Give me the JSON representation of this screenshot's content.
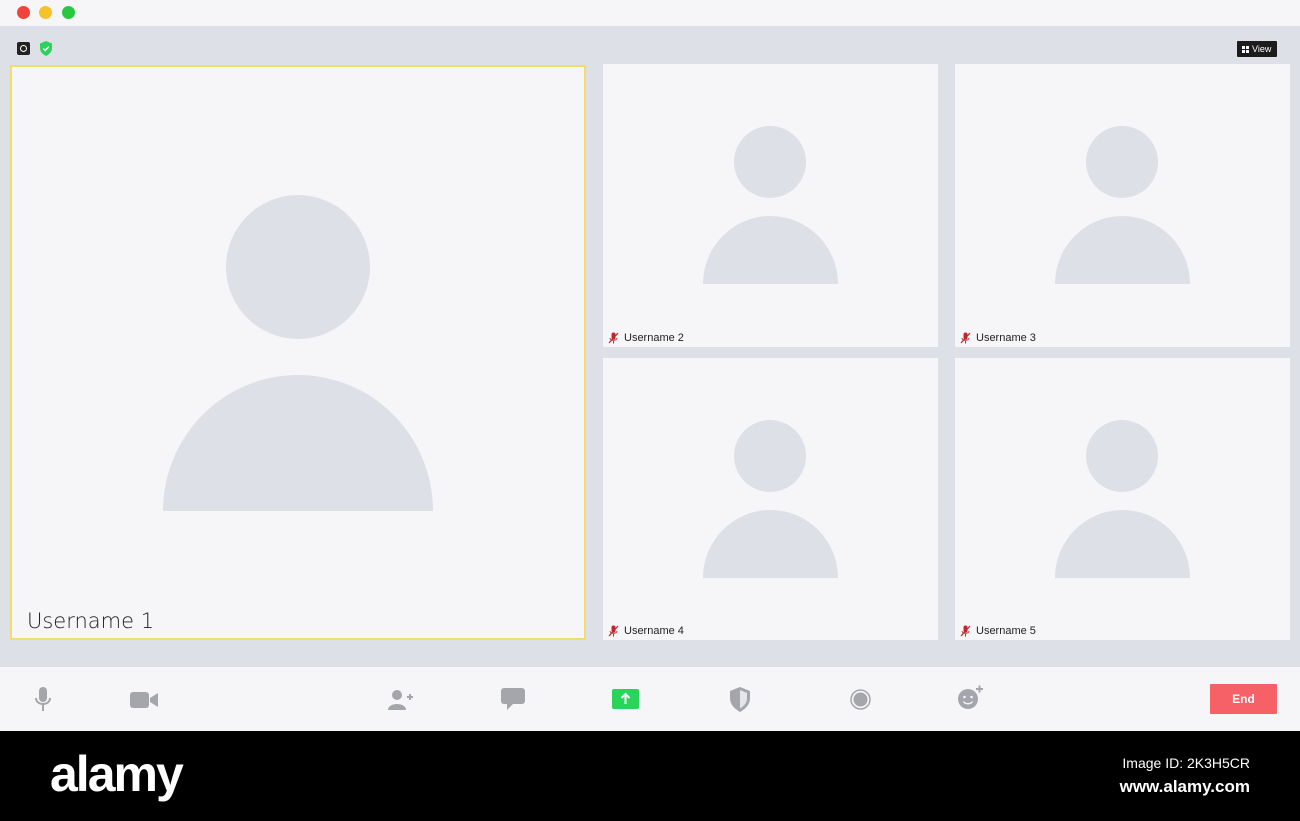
{
  "header": {
    "view_label": "View"
  },
  "participants": {
    "main": {
      "name": "Username 1"
    },
    "tile2": {
      "name": "Username 2"
    },
    "tile3": {
      "name": "Username 3"
    },
    "tile4": {
      "name": "Username 4"
    },
    "tile5": {
      "name": "Username 5"
    }
  },
  "toolbar": {
    "end_label": "End",
    "icons": [
      "microphone-icon",
      "video-camera-icon",
      "add-participant-icon",
      "chat-icon",
      "share-screen-icon",
      "security-icon",
      "record-icon",
      "reactions-icon"
    ]
  },
  "colors": {
    "active_speaker_border": "#f2dd6a",
    "end_button": "#f66168",
    "share_button": "#2ad45a",
    "security_badge": "#2ad45a"
  },
  "footer": {
    "brand": "alamy",
    "image_id": "Image ID: 2K3H5CR",
    "site": "www.alamy.com"
  }
}
